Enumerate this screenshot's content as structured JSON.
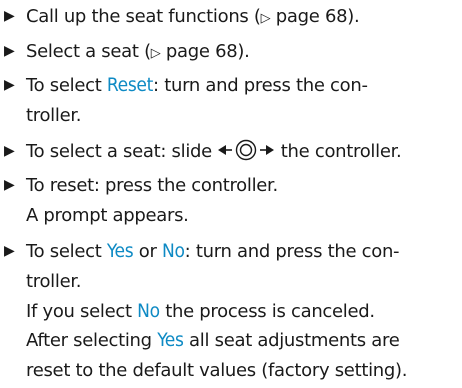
{
  "steps": [
    {
      "bullet": "▶",
      "pre": "Call up the seat functions (",
      "ref_arrow": "▷",
      "ref": " page 68",
      "post": ")."
    },
    {
      "bullet": "▶",
      "pre": "Select a seat (",
      "ref_arrow": "▷",
      "ref": " page 68",
      "post": ")."
    },
    {
      "bullet": "▶",
      "line1_pre": "To select ",
      "line1_kw": "Reset",
      "line1_post": ": turn and press the con-",
      "line2": "troller."
    },
    {
      "bullet": "▶",
      "pre": "To select a seat: slide ",
      "post": " the controller.",
      "icon": "slide-left-right-controller-icon"
    },
    {
      "bullet": "▶",
      "line1": "To reset: press the controller.",
      "line2": "A prompt appears."
    },
    {
      "bullet": "▶",
      "line1_pre": "To select ",
      "kw1": "Yes",
      "mid": " or ",
      "kw2": "No",
      "line1_post": ": turn and press the con-",
      "line2": "troller.",
      "line3_pre": "If you select ",
      "line3_kw": "No",
      "line3_post": " the process is canceled."
    }
  ],
  "final": {
    "pre": "After selecting ",
    "kw": "Yes",
    "post": " all seat adjustments are",
    "line2": "reset to the default values (factory setting)."
  },
  "colors": {
    "keyword": "#0e8ac4",
    "text": "#1a1a1a"
  }
}
